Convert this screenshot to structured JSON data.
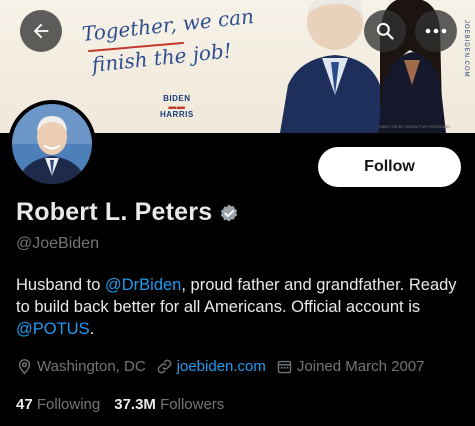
{
  "banner": {
    "script_line1": "Together, we can",
    "script_line2": "finish the job!",
    "logo_top": "BIDEN",
    "logo_bottom": "HARRIS",
    "side_text": "JOEBIDEN.COM",
    "footer_text": "PAID FOR BY BIDEN FOR PRESIDENT"
  },
  "header_controls": {
    "back_icon": "arrow-left-icon",
    "search_icon": "search-icon",
    "more_icon": "more-dots-icon"
  },
  "profile": {
    "name": "Robert L. Peters",
    "handle": "@JoeBiden",
    "follow_label": "Follow",
    "bio": {
      "part1": "Husband to ",
      "mention1": "@DrBiden",
      "part2": ", proud father and grandfather. Ready to build back better for all Americans. Official account is ",
      "mention2": "@POTUS",
      "part3": "."
    },
    "location": "Washington, DC",
    "website": "joebiden.com",
    "joined": "Joined March 2007",
    "following_count": "47",
    "following_label": "Following",
    "followers_count": "37.3M",
    "followers_label": "Followers"
  },
  "colors": {
    "accent": "#1d9bf0",
    "verified": "#9aa2a9",
    "muted": "#71767b",
    "background": "#000000"
  }
}
